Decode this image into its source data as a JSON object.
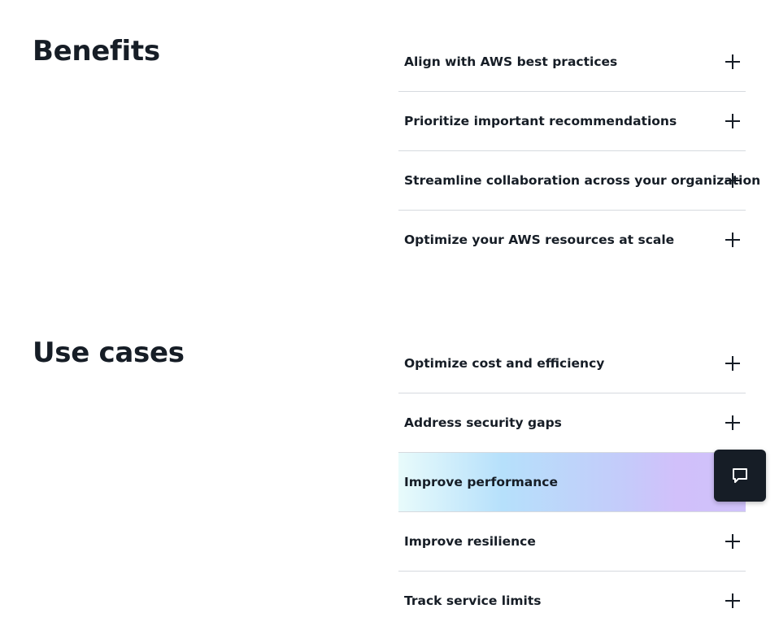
{
  "benefits": {
    "title": "Benefits",
    "items": [
      {
        "label": "Align with AWS best practices"
      },
      {
        "label": "Prioritize important recommendations"
      },
      {
        "label": "Streamline collaboration across your organization"
      },
      {
        "label": "Optimize your AWS resources at scale"
      }
    ]
  },
  "use_cases": {
    "title": "Use cases",
    "items": [
      {
        "label": "Optimize cost and efficiency"
      },
      {
        "label": "Address security gaps"
      },
      {
        "label": "Improve performance"
      },
      {
        "label": "Improve resilience"
      },
      {
        "label": "Track service limits"
      }
    ]
  },
  "chat": {
    "icon": "chat-icon"
  },
  "colors": {
    "text": "#161d26",
    "divider": "#d6dadf",
    "chat_bg": "#161d26"
  }
}
